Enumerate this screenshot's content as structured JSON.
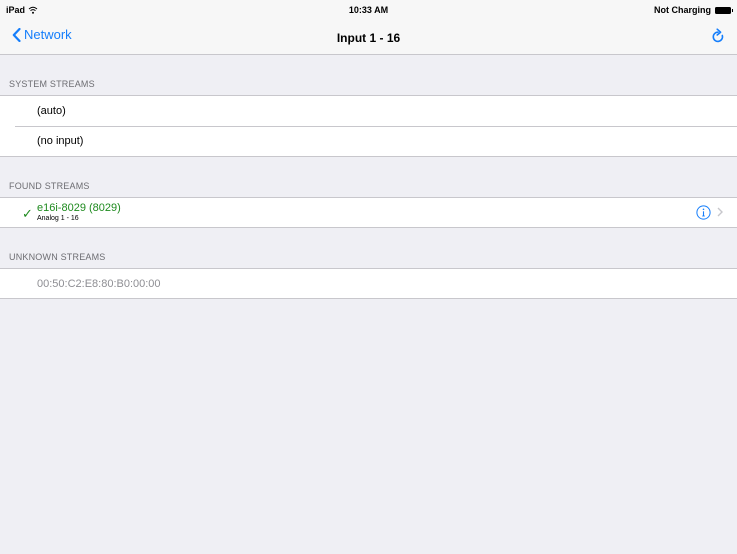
{
  "status_bar": {
    "device": "iPad",
    "time": "10:33 AM",
    "battery_status": "Not Charging"
  },
  "nav": {
    "back_label": "Network",
    "title": "Input 1 - 16"
  },
  "sections": {
    "system": {
      "header": "SYSTEM STREAMS",
      "items": [
        {
          "label": "(auto)"
        },
        {
          "label": "(no input)"
        }
      ]
    },
    "found": {
      "header": "FOUND STREAMS",
      "items": [
        {
          "title": "e16i-8029 (8029)",
          "subtitle": "Analog 1 - 16",
          "selected": true
        }
      ]
    },
    "unknown": {
      "header": "UNKNOWN STREAMS",
      "items": [
        {
          "label": "00:50:C2:E8:80:B0:00:00"
        }
      ]
    }
  },
  "colors": {
    "accent": "#157efb",
    "found_green": "#1e8a1e",
    "background": "#efeff4"
  },
  "icons": [
    "wifi-icon",
    "battery-icon",
    "back-chevron-icon",
    "refresh-icon",
    "checkmark-icon",
    "info-icon",
    "disclosure-chevron-icon"
  ]
}
